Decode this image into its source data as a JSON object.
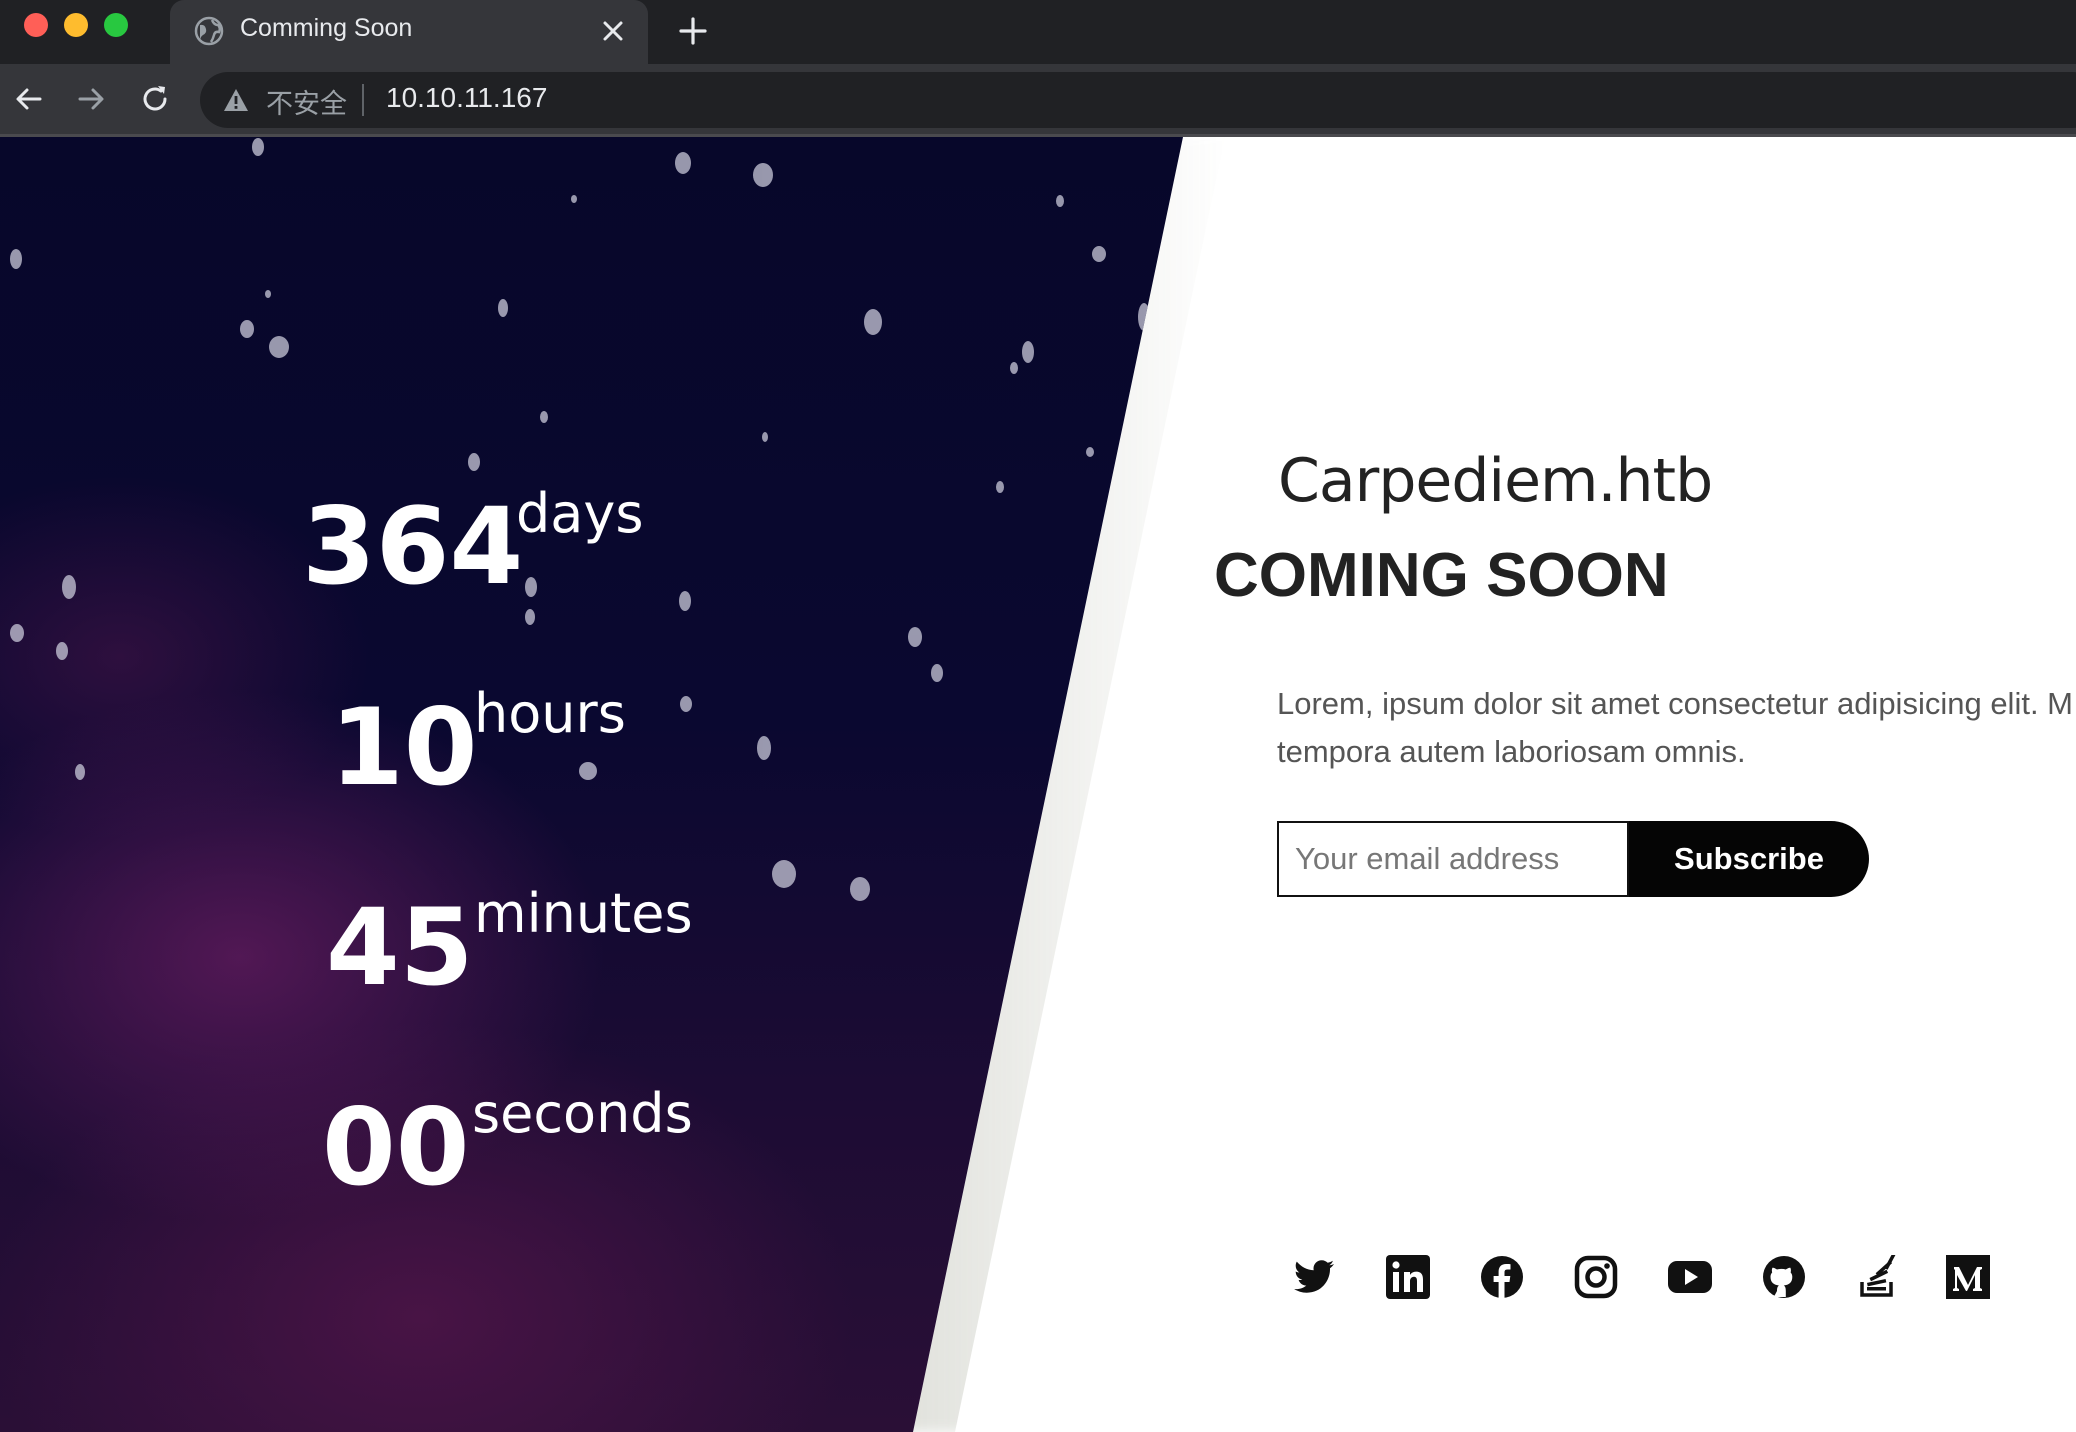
{
  "browser": {
    "tab_title": "Comming Soon",
    "security_label": "不安全",
    "url": "10.10.11.167"
  },
  "countdown": {
    "days": {
      "value": "364",
      "unit": "days"
    },
    "hours": {
      "value": "10",
      "unit": "hours"
    },
    "minutes": {
      "value": "45",
      "unit": "minutes"
    },
    "seconds": {
      "value": "00",
      "unit": "seconds"
    }
  },
  "content": {
    "site_name": "Carpediem.htb",
    "heading": "COMING SOON",
    "lorem_line1": "Lorem, ipsum dolor sit amet consectetur adipisicing elit. M",
    "lorem_line2": "tempora autem laboriosam omnis."
  },
  "subscribe": {
    "email_placeholder": "Your email address",
    "button_label": "Subscribe"
  },
  "social_icons": [
    "twitter-icon",
    "linkedin-icon",
    "facebook-icon",
    "instagram-icon",
    "youtube-icon",
    "github-icon",
    "stackoverflow-icon",
    "medium-icon"
  ],
  "colors": {
    "left_panel_dark": "#07072a",
    "left_panel_purple": "#4a1446",
    "button_bg": "#050505",
    "text_dark": "#222222"
  }
}
